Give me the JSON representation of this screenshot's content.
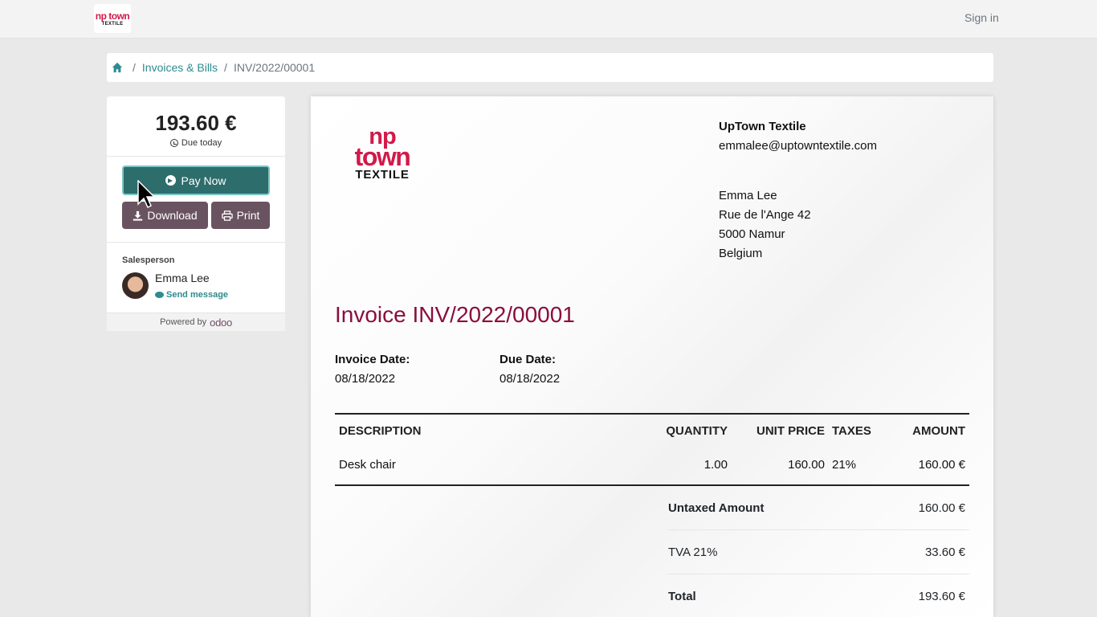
{
  "nav": {
    "logo_top": "np town",
    "logo_bottom": "TEXTILE",
    "signin": "Sign in"
  },
  "breadcrumb": {
    "sep": "/",
    "link": "Invoices & Bills",
    "current": "INV/2022/00001"
  },
  "sidebar": {
    "amount": "193.60 €",
    "due": "Due today",
    "pay_label": "Pay Now",
    "download_label": "Download",
    "print_label": "Print",
    "salesperson_label": "Salesperson",
    "salesperson_name": "Emma Lee",
    "send_message": "Send message",
    "powered_by": "Powered by",
    "brand": "odoo"
  },
  "invoice": {
    "logo_line1": "np",
    "logo_line2": "town",
    "logo_line3": "TEXTILE",
    "company_name": "UpTown Textile",
    "company_email": "emmalee@uptowntextile.com",
    "customer": [
      "Emma Lee",
      "Rue de l'Ange 42",
      "5000 Namur",
      "Belgium"
    ],
    "title": "Invoice INV/2022/00001",
    "invoice_date_label": "Invoice Date:",
    "invoice_date": "08/18/2022",
    "due_date_label": "Due Date:",
    "due_date": "08/18/2022",
    "columns": {
      "description": "DESCRIPTION",
      "quantity": "QUANTITY",
      "unit_price": "UNIT PRICE",
      "taxes": "TAXES",
      "amount": "AMOUNT"
    },
    "lines": [
      {
        "description": "Desk chair",
        "quantity": "1.00",
        "unit_price": "160.00",
        "taxes": "21%",
        "amount": "160.00 €"
      }
    ],
    "totals": [
      {
        "label": "Untaxed Amount",
        "value": "160.00 €"
      },
      {
        "label": "TVA 21%",
        "value": "33.60 €"
      },
      {
        "label": "Total",
        "value": "193.60 €"
      }
    ]
  },
  "colors": {
    "accent": "#2e8b8f",
    "pay_button": "#2d6d6c",
    "secondary_button": "#6a5360",
    "brand_red": "#d11a4a",
    "title": "#8a0e3c"
  }
}
